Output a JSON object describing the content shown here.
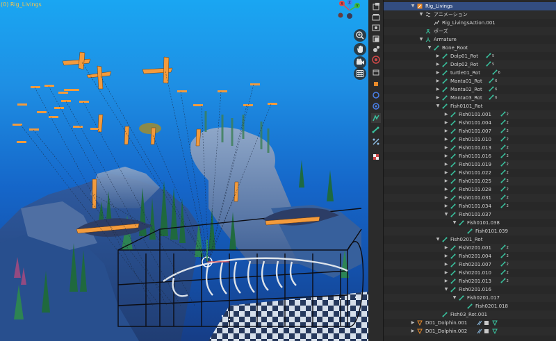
{
  "viewport": {
    "title": "(0) Rig_Livings",
    "colors": {
      "water_top": "#1aa6f2",
      "water_bottom": "#163d86",
      "bone": "#f39b3c"
    }
  },
  "nav_gizmo": {
    "axes": [
      "X",
      "Y",
      "Z"
    ]
  },
  "viewport_tools": [
    {
      "name": "zoom",
      "icon": "zoom-icon"
    },
    {
      "name": "pan",
      "icon": "hand-icon"
    },
    {
      "name": "camera",
      "icon": "camera-icon"
    },
    {
      "name": "grid",
      "icon": "grid-icon"
    }
  ],
  "properties_tabs": [
    "tool-icon",
    "render-icon",
    "output-icon",
    "view-layer-icon",
    "scene-icon",
    "world-icon",
    "collection-icon",
    "object-icon",
    "modifier-icon",
    "particles-icon",
    "physics-icon",
    "object-data-icon",
    "bone-icon",
    "bone-constraint-icon",
    "texture-icon"
  ],
  "outliner": {
    "rows": [
      {
        "label": "Rig_Livings",
        "indent": 0,
        "disc": "down",
        "icon": "armature-object-icon",
        "selected": true
      },
      {
        "label": "アニメーション",
        "indent": 1,
        "disc": "down",
        "icon": "animation-icon"
      },
      {
        "label": "Rig_LivingsAction.001",
        "indent": 2,
        "disc": "",
        "icon": "action-icon"
      },
      {
        "label": "ポーズ",
        "indent": 1,
        "disc": "",
        "icon": "pose-icon"
      },
      {
        "label": "Armature",
        "indent": 1,
        "disc": "down",
        "icon": "armature-data-icon"
      },
      {
        "label": "Bone_Root",
        "indent": 2,
        "disc": "down",
        "icon": "bone-icon"
      },
      {
        "label": "Dolp01_Rot",
        "indent": 3,
        "disc": "right",
        "icon": "bone-icon",
        "badge": "5"
      },
      {
        "label": "Dolp02_Rot",
        "indent": 3,
        "disc": "right",
        "icon": "bone-icon",
        "badge": "5"
      },
      {
        "label": "turtle01_Rot",
        "indent": 3,
        "disc": "right",
        "icon": "bone-icon",
        "badge": "6"
      },
      {
        "label": "Manta01_Rot",
        "indent": 3,
        "disc": "right",
        "icon": "bone-icon",
        "badge": "6"
      },
      {
        "label": "Manta02_Rot",
        "indent": 3,
        "disc": "right",
        "icon": "bone-icon",
        "badge": "6"
      },
      {
        "label": "Manta03_Rot",
        "indent": 3,
        "disc": "right",
        "icon": "bone-icon",
        "badge": "6"
      },
      {
        "label": "Fish0101_Rot",
        "indent": 3,
        "disc": "down",
        "icon": "bone-icon"
      },
      {
        "label": "Fish0101.001",
        "indent": 4,
        "disc": "right",
        "icon": "bone-icon",
        "badge": "2"
      },
      {
        "label": "Fish0101.004",
        "indent": 4,
        "disc": "right",
        "icon": "bone-icon",
        "badge": "2"
      },
      {
        "label": "Fish0101.007",
        "indent": 4,
        "disc": "right",
        "icon": "bone-icon",
        "badge": "2"
      },
      {
        "label": "Fish0101.010",
        "indent": 4,
        "disc": "right",
        "icon": "bone-icon",
        "badge": "2"
      },
      {
        "label": "Fish0101.013",
        "indent": 4,
        "disc": "right",
        "icon": "bone-icon",
        "badge": "2"
      },
      {
        "label": "Fish0101.016",
        "indent": 4,
        "disc": "right",
        "icon": "bone-icon",
        "badge": "2"
      },
      {
        "label": "Fish0101.019",
        "indent": 4,
        "disc": "right",
        "icon": "bone-icon",
        "badge": "2"
      },
      {
        "label": "Fish0101.022",
        "indent": 4,
        "disc": "right",
        "icon": "bone-icon",
        "badge": "2"
      },
      {
        "label": "Fish0101.025",
        "indent": 4,
        "disc": "right",
        "icon": "bone-icon",
        "badge": "2"
      },
      {
        "label": "Fish0101.028",
        "indent": 4,
        "disc": "right",
        "icon": "bone-icon",
        "badge": "2"
      },
      {
        "label": "Fish0101.031",
        "indent": 4,
        "disc": "right",
        "icon": "bone-icon",
        "badge": "2"
      },
      {
        "label": "Fish0101.034",
        "indent": 4,
        "disc": "right",
        "icon": "bone-icon",
        "badge": "2"
      },
      {
        "label": "Fish0101.037",
        "indent": 4,
        "disc": "down",
        "icon": "bone-icon"
      },
      {
        "label": "Fish0101.038",
        "indent": 5,
        "disc": "down",
        "icon": "bone-icon"
      },
      {
        "label": "Fish0101.039",
        "indent": 6,
        "disc": "",
        "icon": "bone-icon"
      },
      {
        "label": "Fish0201_Rot",
        "indent": 3,
        "disc": "down",
        "icon": "bone-icon"
      },
      {
        "label": "Fish0201.001",
        "indent": 4,
        "disc": "right",
        "icon": "bone-icon",
        "badge": "2"
      },
      {
        "label": "Fish0201.004",
        "indent": 4,
        "disc": "right",
        "icon": "bone-icon",
        "badge": "2"
      },
      {
        "label": "Fish0201.007",
        "indent": 4,
        "disc": "right",
        "icon": "bone-icon",
        "badge": "2"
      },
      {
        "label": "Fish0201.010",
        "indent": 4,
        "disc": "right",
        "icon": "bone-icon",
        "badge": "2"
      },
      {
        "label": "Fish0201.013",
        "indent": 4,
        "disc": "right",
        "icon": "bone-icon",
        "badge": "2"
      },
      {
        "label": "Fish0201.016",
        "indent": 4,
        "disc": "down",
        "icon": "bone-icon"
      },
      {
        "label": "Fish0201.017",
        "indent": 5,
        "disc": "down",
        "icon": "bone-icon"
      },
      {
        "label": "Fish0201.018",
        "indent": 6,
        "disc": "",
        "icon": "bone-icon"
      },
      {
        "label": "Fish03_Rot.001",
        "indent": 3,
        "disc": "",
        "icon": "bone-icon"
      },
      {
        "label": "D01_Dolphin.001",
        "indent": 0,
        "disc": "right",
        "icon": "mesh-object-icon",
        "objicons": true
      },
      {
        "label": "D01_Dolphin.002",
        "indent": 0,
        "disc": "right",
        "icon": "mesh-object-icon",
        "objicons": true
      }
    ]
  }
}
